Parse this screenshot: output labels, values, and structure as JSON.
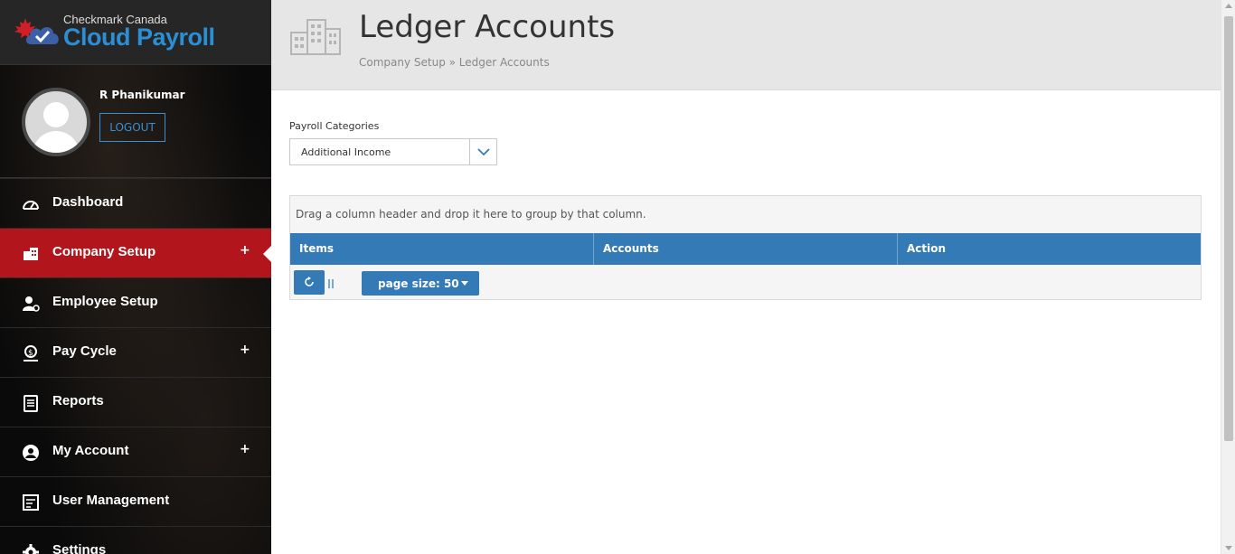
{
  "brand": {
    "small": "Checkmark Canada",
    "big": "Cloud Payroll"
  },
  "user": {
    "name": "R Phanikumar",
    "logout_label": "LOGOUT"
  },
  "menu": [
    {
      "label": "Dashboard",
      "icon": "dashboard-icon",
      "expandable": false
    },
    {
      "label": "Company Setup",
      "icon": "company-icon",
      "expandable": true,
      "active": true
    },
    {
      "label": "Employee Setup",
      "icon": "employee-settings-icon",
      "expandable": false
    },
    {
      "label": "Pay Cycle",
      "icon": "pay-cycle-icon",
      "expandable": true
    },
    {
      "label": "Reports",
      "icon": "reports-icon",
      "expandable": false
    },
    {
      "label": "My Account",
      "icon": "account-icon",
      "expandable": true
    },
    {
      "label": "User Management",
      "icon": "user-management-icon",
      "expandable": false
    },
    {
      "label": "Settings",
      "icon": "gear-icon",
      "expandable": false
    }
  ],
  "menu_plus": "+",
  "header": {
    "title": "Ledger Accounts",
    "breadcrumb": "Company Setup » Ledger Accounts"
  },
  "filter": {
    "label": "Payroll Categories",
    "value": "Additional Income"
  },
  "grid": {
    "group_hint": "Drag a column header and drop it here to group by that column.",
    "columns": [
      "Items",
      "Accounts",
      "Action"
    ],
    "rows": [],
    "page_size_label": "page size: 50"
  },
  "colors": {
    "accent": "#337ab7",
    "active_menu": "#b2161c",
    "brand_blue": "#2b8fd6"
  }
}
